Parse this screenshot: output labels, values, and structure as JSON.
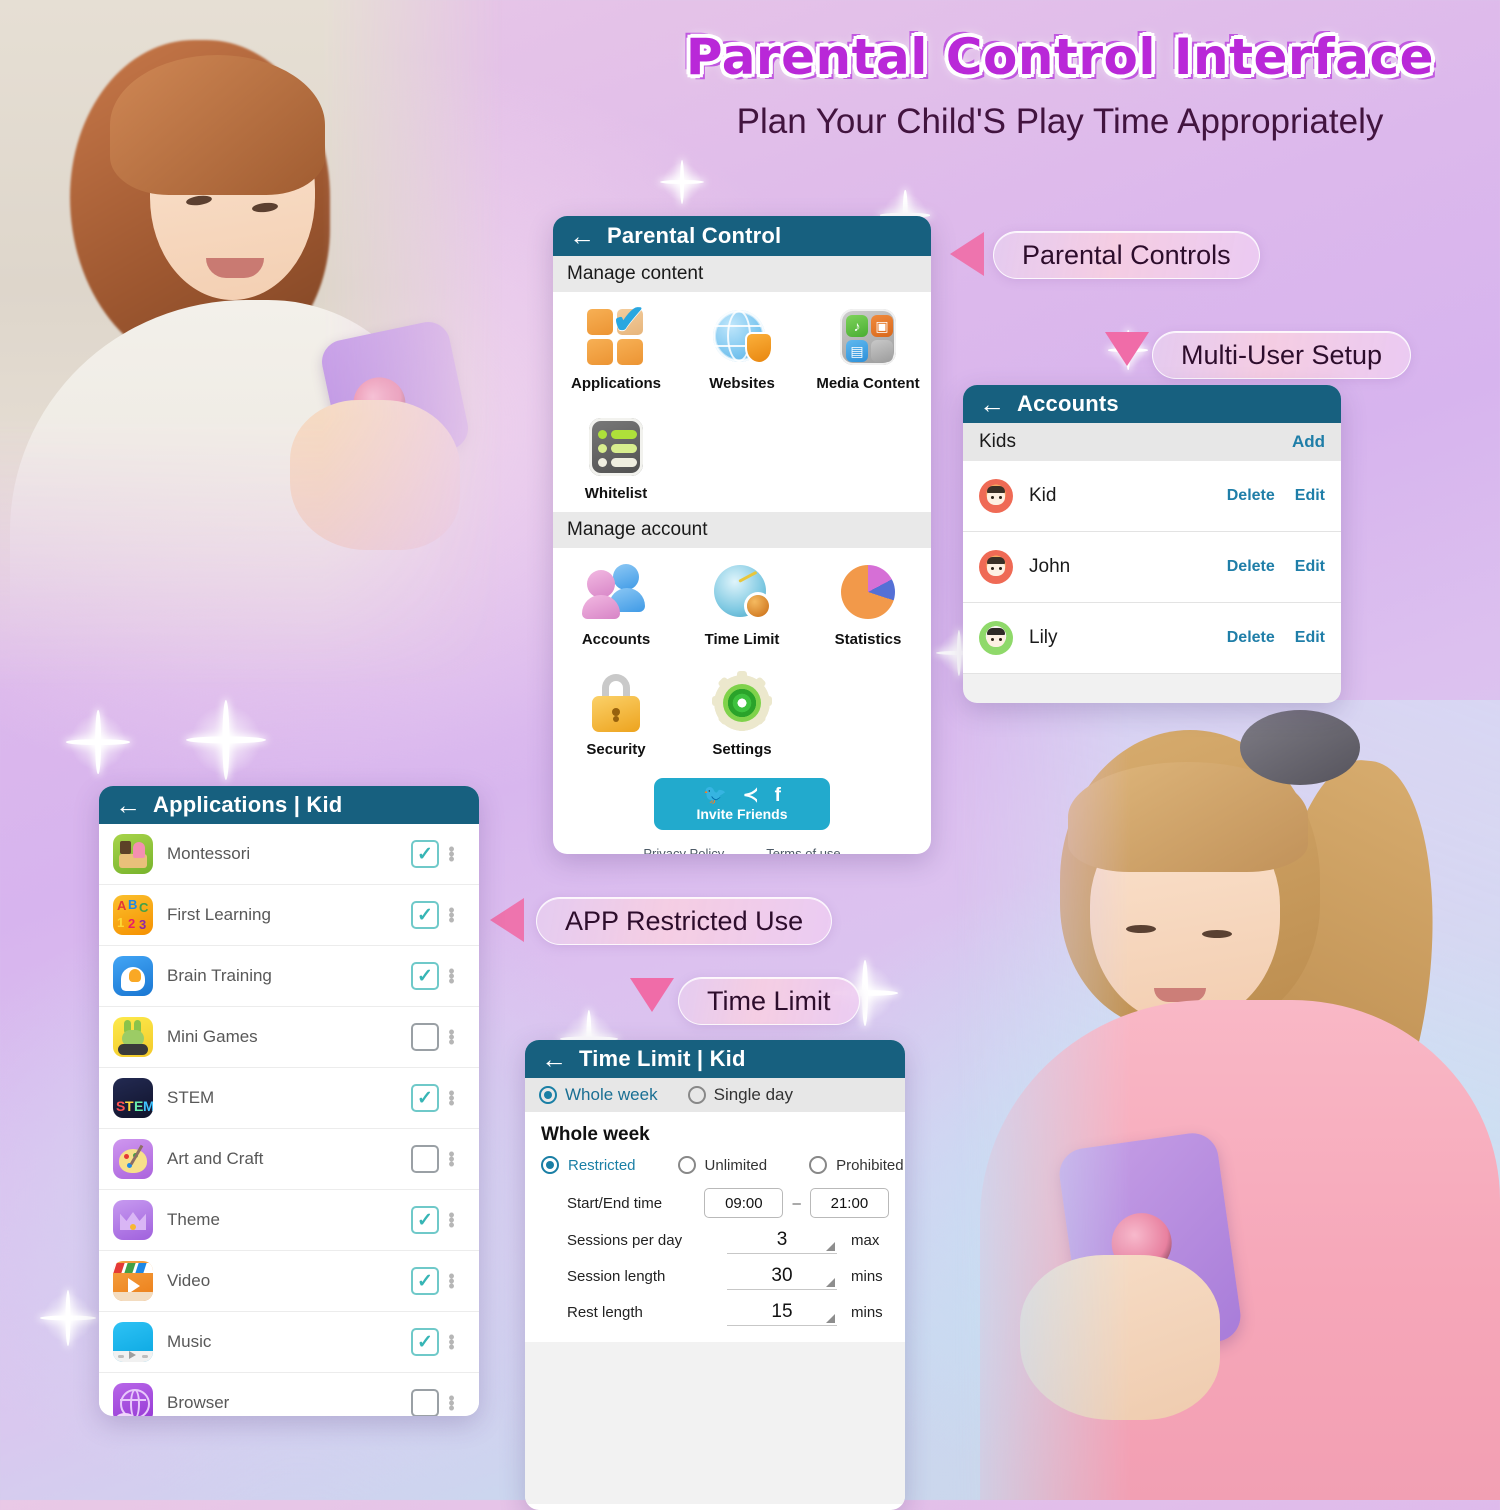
{
  "headline": {
    "title": "Parental Control Interface",
    "subtitle": "Plan Your Child'S Play Time Appropriately"
  },
  "callouts": [
    {
      "label": "Parental Controls",
      "marker": "triangle-left"
    },
    {
      "label": "Multi-User Setup",
      "marker": "triangle-down"
    },
    {
      "label": "APP Restricted Use",
      "marker": "triangle-left"
    },
    {
      "label": "Time Limit",
      "marker": "triangle-down"
    }
  ],
  "colors": {
    "header_bar": "#17607f",
    "link": "#1f7ea8",
    "invite_button": "#22aacd",
    "checkbox_on": "#36b5b5",
    "title_purple": "#b928d8"
  },
  "parental_control": {
    "back_icon": "back-arrow-icon",
    "title": "Parental Control",
    "sections": [
      {
        "heading": "Manage content",
        "tiles": [
          {
            "label": "Applications",
            "icon": "applications-icon"
          },
          {
            "label": "Websites",
            "icon": "globe-shield-icon"
          },
          {
            "label": "Media Content",
            "icon": "media-folder-icon"
          },
          {
            "label": "Whitelist",
            "icon": "whitelist-icon"
          }
        ]
      },
      {
        "heading": "Manage account",
        "tiles": [
          {
            "label": "Accounts",
            "icon": "people-icon"
          },
          {
            "label": "Time Limit",
            "icon": "clock-lock-icon"
          },
          {
            "label": "Statistics",
            "icon": "pie-chart-icon"
          },
          {
            "label": "Security",
            "icon": "padlock-icon"
          },
          {
            "label": "Settings",
            "icon": "gear-icon"
          }
        ]
      }
    ],
    "invite": {
      "label": "Invite Friends",
      "socials": [
        "twitter-icon",
        "share-icon",
        "facebook-icon"
      ]
    },
    "footer_links": [
      "Privacy Policy",
      "Terms of use"
    ]
  },
  "accounts": {
    "back_icon": "back-arrow-icon",
    "title": "Accounts",
    "group_label": "Kids",
    "add_label": "Add",
    "rows": [
      {
        "name": "Kid",
        "avatar": "avatar-tiger-orange",
        "delete": "Delete",
        "edit": "Edit"
      },
      {
        "name": "John",
        "avatar": "avatar-tiger-orange",
        "delete": "Delete",
        "edit": "Edit"
      },
      {
        "name": "Lily",
        "avatar": "avatar-bunny-green",
        "delete": "Delete",
        "edit": "Edit"
      }
    ]
  },
  "applications": {
    "back_icon": "back-arrow-icon",
    "title": "Applications | Kid",
    "rows": [
      {
        "name": "Montessori",
        "checked": true,
        "icon": "montessori-app-icon",
        "icon_bg": "#8dc63f"
      },
      {
        "name": "First Learning",
        "checked": true,
        "icon": "abc123-app-icon",
        "icon_bg": "#f7a823"
      },
      {
        "name": "Brain Training",
        "checked": true,
        "icon": "brain-app-icon",
        "icon_bg": "#2e9fe0"
      },
      {
        "name": "Mini Games",
        "checked": false,
        "icon": "minigames-app-icon",
        "icon_bg": "#f2d22e"
      },
      {
        "name": "STEM",
        "checked": true,
        "icon": "stem-app-icon",
        "icon_bg": "#1b1f3b"
      },
      {
        "name": "Art and Craft",
        "checked": false,
        "icon": "palette-app-icon",
        "icon_bg": "#c municipal"
      },
      {
        "name": "Theme",
        "checked": true,
        "icon": "crown-app-icon",
        "icon_bg": "#b07ee0"
      },
      {
        "name": "Video",
        "checked": true,
        "icon": "video-app-icon",
        "icon_bg": "#f08a2a"
      },
      {
        "name": "Music",
        "checked": true,
        "icon": "music-app-icon",
        "icon_bg": "#18b5ef"
      },
      {
        "name": "Browser",
        "checked": false,
        "icon": "browser-app-icon",
        "icon_bg": "#a94fe0"
      }
    ],
    "menu_icon": "kebab-menu-icon",
    "checkbox_glyph": "✓"
  },
  "time_limit": {
    "back_icon": "back-arrow-icon",
    "title": "Time Limit | Kid",
    "scope_tabs": [
      {
        "label": "Whole week",
        "selected": true
      },
      {
        "label": "Single day",
        "selected": false
      }
    ],
    "section_title": "Whole week",
    "modes": [
      {
        "label": "Restricted",
        "selected": true
      },
      {
        "label": "Unlimited",
        "selected": false
      },
      {
        "label": "Prohibited",
        "selected": false
      }
    ],
    "fields": {
      "start_end_label": "Start/End time",
      "start_time": "09:00",
      "separator": "–",
      "end_time": "21:00",
      "sessions_label": "Sessions per day",
      "sessions_value": "3",
      "sessions_unit": "max",
      "session_length_label": "Session length",
      "session_length_value": "30",
      "session_length_unit": "mins",
      "rest_length_label": "Rest length",
      "rest_length_value": "15",
      "rest_length_unit": "mins"
    }
  }
}
